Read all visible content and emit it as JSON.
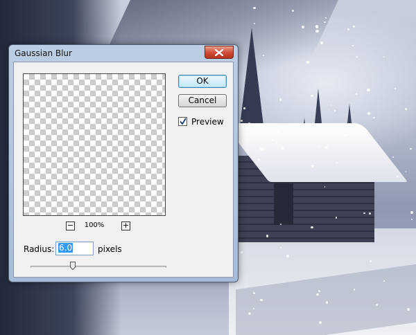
{
  "dialog": {
    "title": "Gaussian Blur",
    "ok_label": "OK",
    "cancel_label": "Cancel",
    "preview_label": "Preview",
    "preview_checked": true,
    "zoom": {
      "minus_label": "−",
      "plus_label": "+",
      "level": "100%"
    },
    "radius": {
      "label": "Radius:",
      "value": "6.0",
      "units": "pixels",
      "slider_fraction": 0.31
    }
  },
  "icons": {
    "close": "close-icon",
    "checkmark": "checkmark-icon"
  },
  "colors": {
    "close_button": "#c7452f",
    "selection_highlight": "#3399ff",
    "title_bar": "#b3c7e2"
  }
}
